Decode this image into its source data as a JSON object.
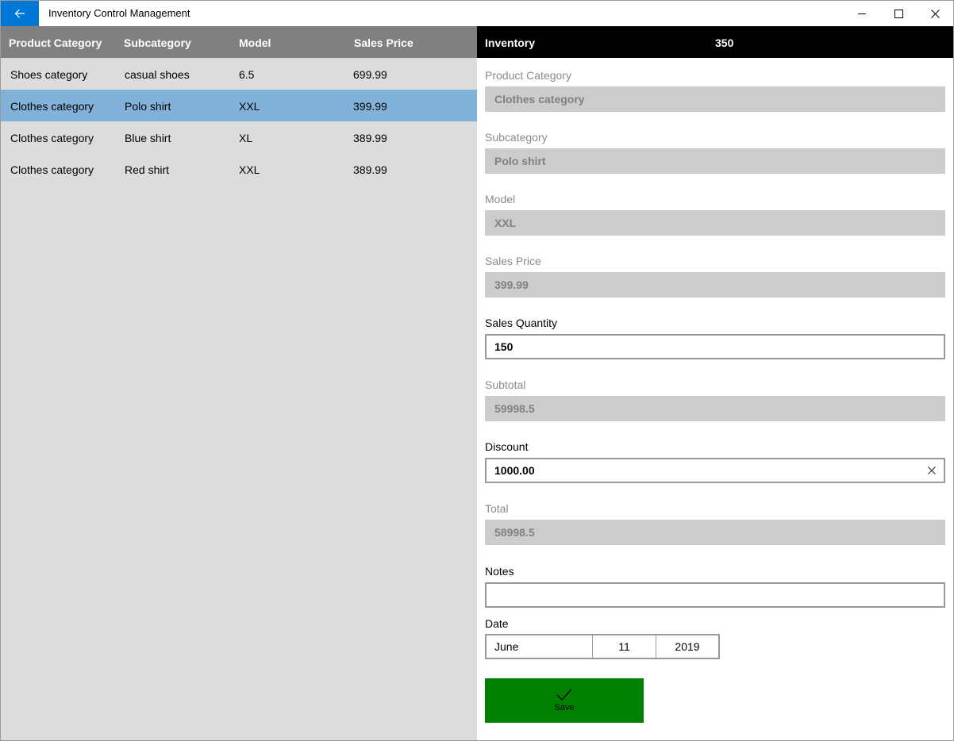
{
  "window": {
    "title": "Inventory Control Management",
    "icons": [
      "back-arrow-icon",
      "minimize-icon",
      "maximize-icon",
      "close-icon"
    ]
  },
  "grid": {
    "headers": [
      "Product Category",
      "Subcategory",
      "Model",
      "Sales Price"
    ],
    "rows": [
      [
        "Shoes category",
        "casual shoes",
        "6.5",
        "699.99"
      ],
      [
        "Clothes category",
        "Polo shirt",
        "XXL",
        "399.99"
      ],
      [
        "Clothes category",
        "Blue shirt",
        "XL",
        "389.99"
      ],
      [
        "Clothes category",
        "Red shirt",
        "XXL",
        "389.99"
      ]
    ],
    "selected_row": 1
  },
  "inventory": {
    "label": "Inventory",
    "value": "350"
  },
  "form": {
    "product_category": {
      "label": "Product Category",
      "value": "Clothes category"
    },
    "subcategory": {
      "label": "Subcategory",
      "value": "Polo shirt"
    },
    "model": {
      "label": "Model",
      "value": "XXL"
    },
    "sales_price": {
      "label": "Sales Price",
      "value": "399.99"
    },
    "sales_quantity": {
      "label": "Sales Quantity",
      "value": "150"
    },
    "subtotal": {
      "label": "Subtotal",
      "value": "59998.5"
    },
    "discount": {
      "label": "Discount",
      "value": "1000.00"
    },
    "total": {
      "label": "Total",
      "value": "58998.5"
    },
    "notes": {
      "label": "Notes",
      "value": ""
    },
    "date": {
      "label": "Date",
      "month": "June",
      "day": "11",
      "year": "2019"
    },
    "save": {
      "label": "Save",
      "icon": "checkmark-icon"
    }
  },
  "colors": {
    "accent": "#0078d7",
    "grid_header": "#808080",
    "selected_row": "#82b2da",
    "list_background": "#dcdcdc",
    "save_button": "#008000",
    "readonly_field": "#cccccc"
  }
}
